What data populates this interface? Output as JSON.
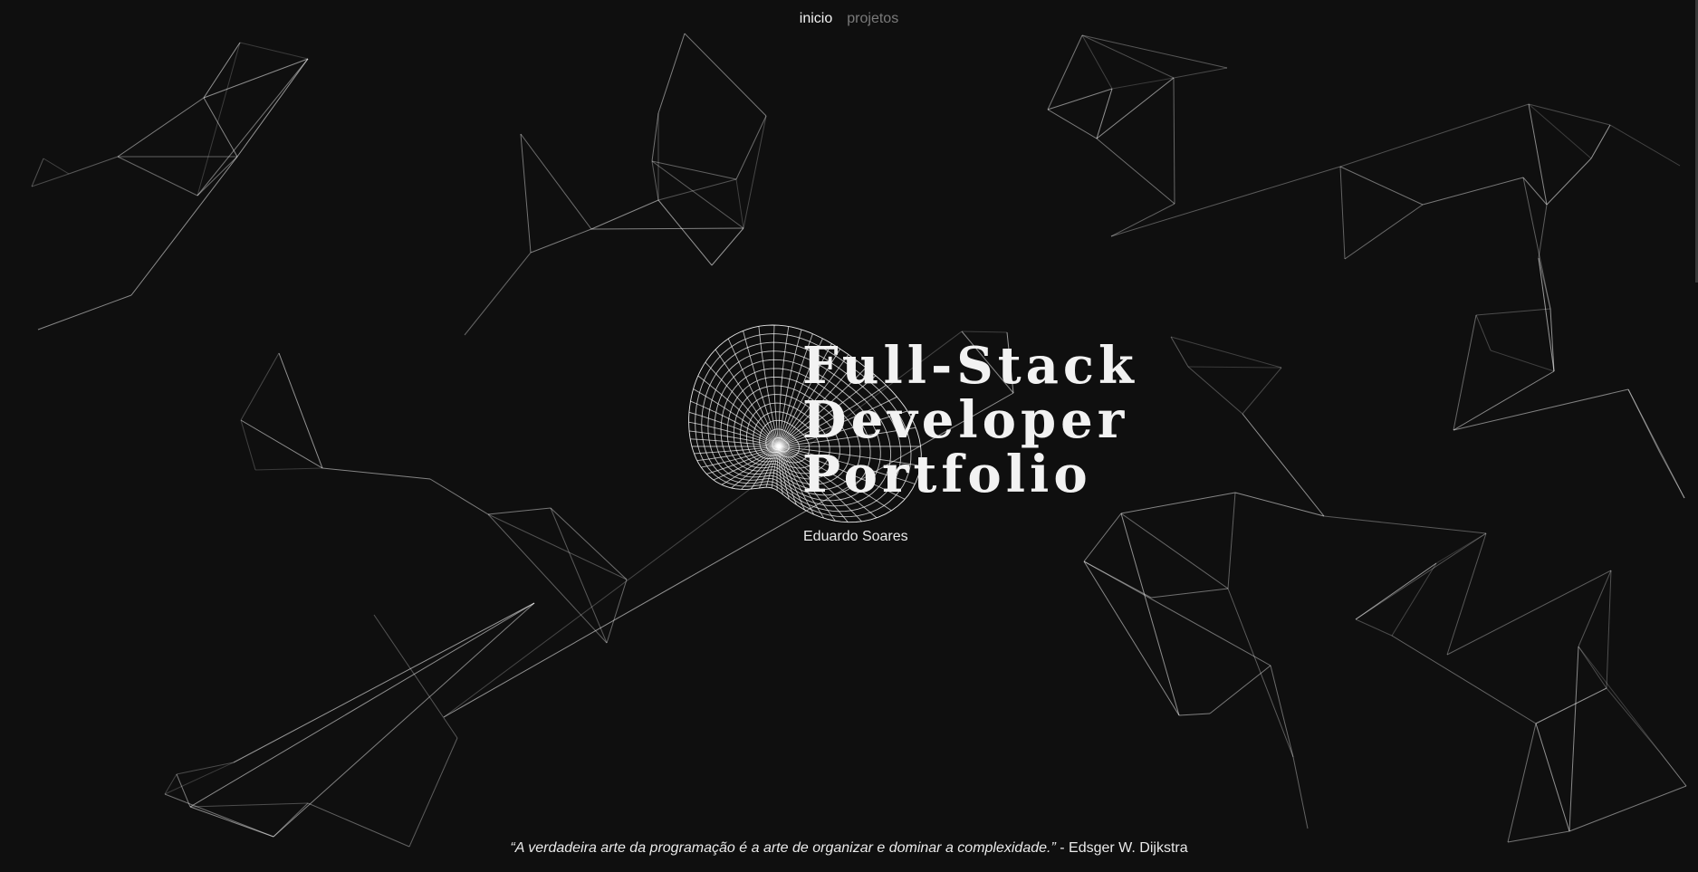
{
  "nav": {
    "items": [
      {
        "label": "inicio",
        "active": true
      },
      {
        "label": "projetos",
        "active": false
      }
    ]
  },
  "hero": {
    "title_lines": [
      "Full-Stack",
      "Developer",
      "Portfolio"
    ],
    "name": "Eduardo Soares"
  },
  "footer": {
    "quote": "“A verdadeira arte da programação é a arte de organizar e dominar a complexidade.”",
    "author": "- Edsger W. Dijkstra"
  },
  "colors": {
    "background": "#0f0f0f",
    "text": "#f2f2f2",
    "muted": "#7a7a7a",
    "lines": "#ffffff"
  }
}
